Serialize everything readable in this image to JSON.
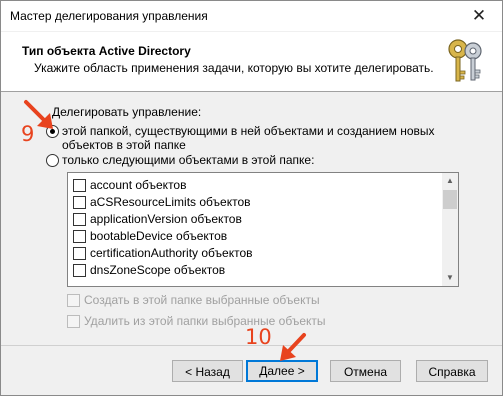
{
  "window": {
    "title": "Мастер делегирования управления",
    "close_symbol": "✕"
  },
  "header": {
    "title": "Тип объекта Active Directory",
    "subtitle": "Укажите область применения задачи, которую вы хотите делегировать."
  },
  "delegate": {
    "group_label": "Делегировать управление:",
    "option1_label": "этой папкой, существующими в ней объектами и созданием новых объектов в этой папке",
    "option2_label": "только следующими объектами в этой папке:"
  },
  "object_list": {
    "items": [
      "account объектов",
      "aCSResourceLimits объектов",
      "applicationVersion объектов",
      "bootableDevice объектов",
      "certificationAuthority объектов",
      "dnsZoneScope объектов"
    ]
  },
  "options": {
    "create_label": "Создать в этой папке выбранные объекты",
    "delete_label": "Удалить из этой папки выбранные объекты"
  },
  "buttons": {
    "back": "< Назад",
    "next": "Далее >",
    "cancel": "Отмена",
    "help": "Справка"
  },
  "annotations": {
    "step9": "9",
    "step10": "10",
    "color": "#e8431e"
  }
}
